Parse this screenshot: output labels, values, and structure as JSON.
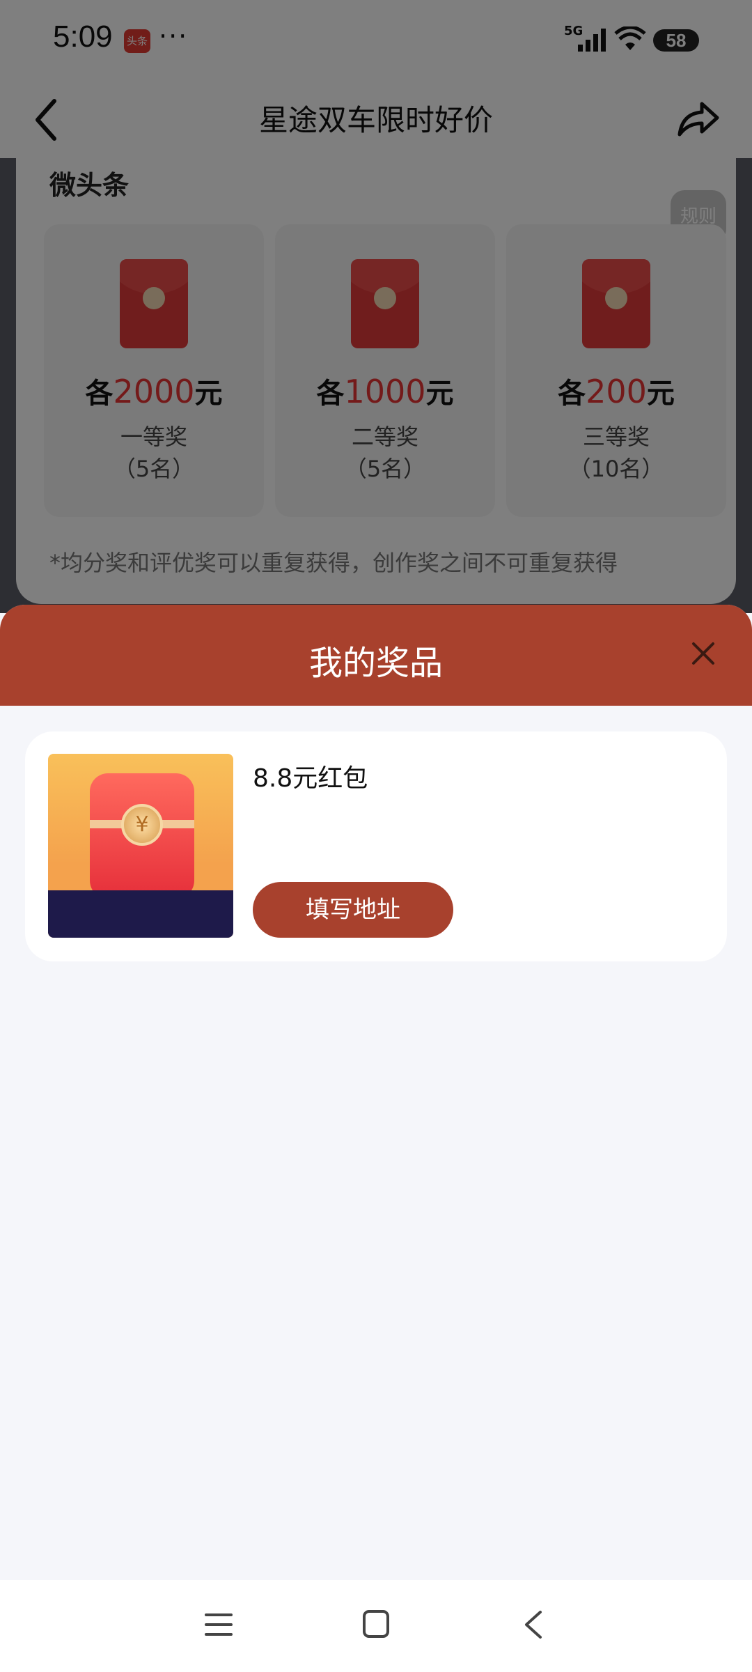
{
  "status_bar": {
    "time": "5:09",
    "app_badge": "头条",
    "more_dots": "···",
    "network": "5G",
    "battery": "58"
  },
  "nav": {
    "title": "星途双车限时好价",
    "back_icon": "back-icon",
    "share_icon": "share-icon"
  },
  "background": {
    "section_title": "微头条",
    "rules_label": "规则",
    "prizes": [
      {
        "prefix": "各",
        "amount": "2000",
        "unit": "元",
        "tier": "一等奖",
        "count": "（5名）"
      },
      {
        "prefix": "各",
        "amount": "1000",
        "unit": "元",
        "tier": "二等奖",
        "count": "（5名）"
      },
      {
        "prefix": "各",
        "amount": "200",
        "unit": "元",
        "tier": "三等奖",
        "count": "（10名）"
      }
    ],
    "footnote": "*均分奖和评优奖可以重复获得，创作奖之间不可重复获得"
  },
  "sheet": {
    "title": "我的奖品",
    "close_icon": "close-icon",
    "items": [
      {
        "name": "8.8元红包",
        "action_label": "填写地址"
      }
    ]
  },
  "system_nav": {
    "menu_icon": "menu-icon",
    "home_icon": "home-icon",
    "back_icon": "back-icon"
  },
  "colors": {
    "sheet_header": "#a8412d",
    "accent_red": "#e83434",
    "button": "#a8412d"
  }
}
